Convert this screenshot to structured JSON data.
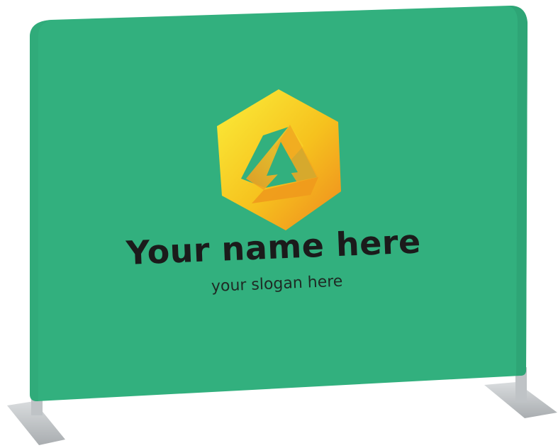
{
  "banner": {
    "name": "Your name here",
    "slogan": "your slogan here"
  },
  "colors": {
    "fabric": "#32b07e",
    "fabric_edge": "#2a9a6d",
    "logo_light": "#f7e21f",
    "logo_dark": "#f08a1c",
    "foot": "#c9cdd0",
    "text": "#1b1b1b"
  },
  "icons": {
    "logo": "impossible-hexagon-logo-icon"
  }
}
